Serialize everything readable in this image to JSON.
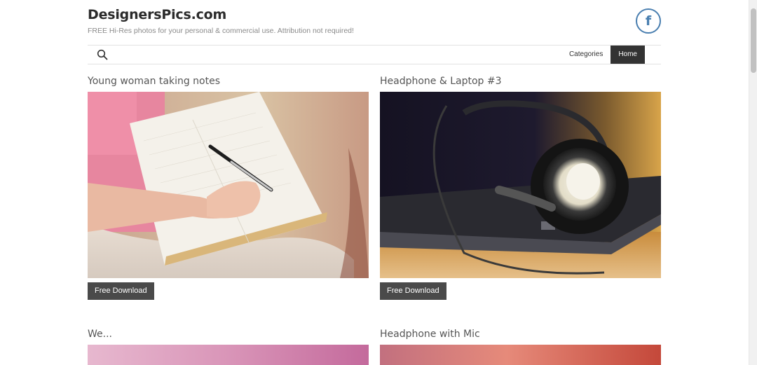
{
  "header": {
    "site_title": "DesignersPics.com",
    "tagline": "FREE Hi-Res photos for your personal & commercial use. Attribution not required!",
    "facebook_glyph": "f"
  },
  "nav": {
    "search_icon": "search-icon",
    "items": [
      {
        "label": "Categories",
        "active": false
      },
      {
        "label": "Home",
        "active": true
      }
    ]
  },
  "posts": [
    {
      "title": "Young woman taking notes",
      "button": "Free Download"
    },
    {
      "title": "Headphone & Laptop #3",
      "button": "Free Download"
    },
    {
      "title": "We...",
      "button": ""
    },
    {
      "title": "Headphone with Mic",
      "button": ""
    }
  ],
  "colors": {
    "accent_dark": "#333333",
    "facebook_blue": "#4a7fb0",
    "button_bg": "#4a4a4a"
  }
}
